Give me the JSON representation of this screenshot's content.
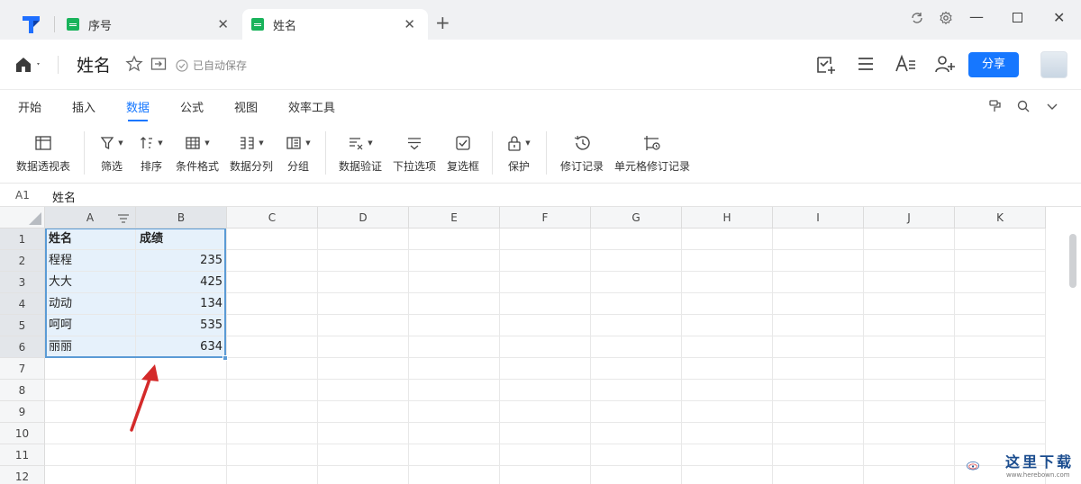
{
  "tabs": [
    {
      "label": "序号",
      "active": false
    },
    {
      "label": "姓名",
      "active": true
    }
  ],
  "doc": {
    "title": "姓名",
    "saved_status": "已自动保存",
    "share_label": "分享"
  },
  "menu": [
    "开始",
    "插入",
    "数据",
    "公式",
    "视图",
    "效率工具"
  ],
  "active_menu": "数据",
  "ribbon": {
    "pivot": "数据透视表",
    "filter": "筛选",
    "sort": "排序",
    "conditional": "条件格式",
    "split": "数据分列",
    "group": "分组",
    "validation": "数据验证",
    "dropdown": "下拉选项",
    "checkbox": "复选框",
    "protect": "保护",
    "history": "修订记录",
    "cell_history": "单元格修订记录"
  },
  "formula_bar": {
    "cell_ref": "A1",
    "content": "姓名"
  },
  "columns": [
    "A",
    "B",
    "C",
    "D",
    "E",
    "F",
    "G",
    "H",
    "I",
    "J",
    "K"
  ],
  "rows": [
    "1",
    "2",
    "3",
    "4",
    "5",
    "6",
    "7",
    "8",
    "9",
    "10",
    "11",
    "12"
  ],
  "table": {
    "headers": [
      "姓名",
      "成绩"
    ],
    "rows": [
      [
        "程程",
        "235"
      ],
      [
        "大大",
        "425"
      ],
      [
        "动动",
        "134"
      ],
      [
        "呵呵",
        "535"
      ],
      [
        "丽丽",
        "634"
      ]
    ]
  },
  "watermark": {
    "text": "这里下载",
    "url": "www.herebown.com"
  },
  "colors": {
    "accent": "#1677ff",
    "selection_border": "#5b9bd5",
    "selection_fill": "#e6f1fb",
    "sheet_icon": "#19b35b",
    "arrow": "#d42a2a"
  }
}
